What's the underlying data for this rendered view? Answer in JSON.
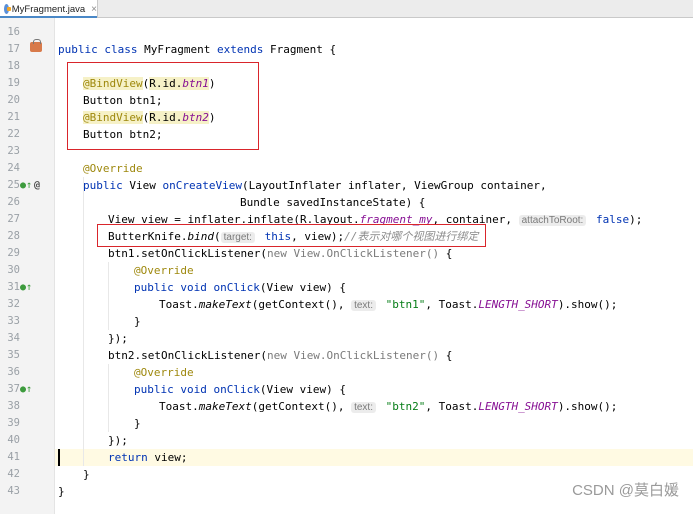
{
  "tab": {
    "file_name": "MyFragment.java",
    "close_glyph": "×"
  },
  "line_numbers": [
    "16",
    "17",
    "18",
    "19",
    "20",
    "21",
    "22",
    "23",
    "24",
    "25",
    "26",
    "27",
    "28",
    "29",
    "30",
    "31",
    "32",
    "33",
    "34",
    "35",
    "36",
    "37",
    "38",
    "39",
    "40",
    "41",
    "42",
    "43"
  ],
  "gutter_icons": {
    "override_glyph": "●↑",
    "at_glyph": "@"
  },
  "code": {
    "l17": {
      "kw1": "public class",
      "name": " MyFragment ",
      "kw2": "extends",
      "rest": " Fragment {"
    },
    "l19": {
      "ann": "@BindView",
      "open": "(",
      "rid": "R.id.",
      "fld": "btn1",
      "close": ")"
    },
    "l20": {
      "text": "Button btn1;"
    },
    "l21": {
      "ann": "@BindView",
      "open": "(",
      "rid": "R.id.",
      "fld": "btn2",
      "close": ")"
    },
    "l22": {
      "text": "Button btn2;"
    },
    "l24": {
      "ann": "@Override"
    },
    "l25": {
      "kw": "public",
      "text": " View ",
      "method": "onCreateView",
      "args": "(LayoutInflater inflater, ViewGroup container,"
    },
    "l26": {
      "text": "Bundle savedInstanceState) {"
    },
    "l27": {
      "pre": "View view = inflater.inflate(R.layout.",
      "fld": "fragment_my",
      "mid": ", container, ",
      "hint": "attachToRoot:",
      "kw": " false",
      "end": ");"
    },
    "l28": {
      "pre": "ButterKnife.",
      "st": "bind",
      "open": "(",
      "hint": "target:",
      "kw": " this",
      "mid": ", view);",
      "comment": "//表示对哪个视图进行绑定"
    },
    "l29": {
      "pre": "btn1.setOnClickListener(",
      "gray": "new View.OnClickListener()",
      "end": " {"
    },
    "l30": {
      "ann": "@Override"
    },
    "l31": {
      "kw": "public void",
      "method": " onClick",
      "end": "(View view) {"
    },
    "l32": {
      "pre": "Toast.",
      "st": "makeText",
      "mid": "(getContext(), ",
      "hint": "text:",
      "str": " \"btn1\"",
      "mid2": ", Toast.",
      "fld": "LENGTH_SHORT",
      "end": ").show();"
    },
    "l33": {
      "text": "}"
    },
    "l34": {
      "text": "});"
    },
    "l35": {
      "pre": "btn2.setOnClickListener(",
      "gray": "new View.OnClickListener()",
      "end": " {"
    },
    "l36": {
      "ann": "@Override"
    },
    "l37": {
      "kw": "public void",
      "method": " onClick",
      "end": "(View view) {"
    },
    "l38": {
      "pre": "Toast.",
      "st": "makeText",
      "mid": "(getContext(), ",
      "hint": "text:",
      "str": " \"btn2\"",
      "mid2": ", Toast.",
      "fld": "LENGTH_SHORT",
      "end": ").show();"
    },
    "l39": {
      "text": "}"
    },
    "l40": {
      "text": "});"
    },
    "l41": {
      "kw": "return",
      "rest": " view;"
    },
    "l42": {
      "text": "}"
    },
    "l43": {
      "text": "}"
    }
  },
  "watermark": "CSDN @莫白媛",
  "colors": {
    "keyword": "#0033b3",
    "annotation": "#9e880d",
    "field": "#871094",
    "string": "#067d17",
    "comment": "#8c8c8c",
    "highlight_box": "#d9252b"
  }
}
